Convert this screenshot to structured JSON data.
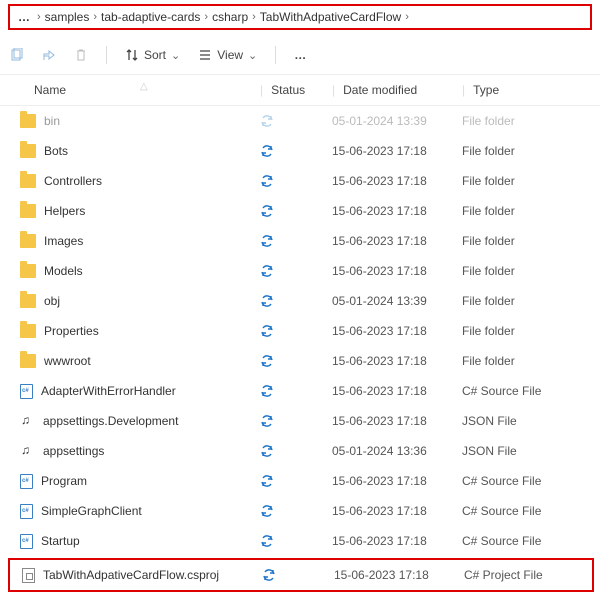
{
  "breadcrumb": {
    "items": [
      "samples",
      "tab-adaptive-cards",
      "csharp",
      "TabWithAdpativeCardFlow"
    ]
  },
  "toolbar": {
    "sort_label": "Sort",
    "view_label": "View"
  },
  "headers": {
    "name": "Name",
    "status": "Status",
    "date": "Date modified",
    "type": "Type"
  },
  "rows": [
    {
      "icon": "folder",
      "name": "bin",
      "date": "05-01-2024 13:39",
      "type": "File folder",
      "faded": true
    },
    {
      "icon": "folder",
      "name": "Bots",
      "date": "15-06-2023 17:18",
      "type": "File folder",
      "faded": false
    },
    {
      "icon": "folder",
      "name": "Controllers",
      "date": "15-06-2023 17:18",
      "type": "File folder",
      "faded": false
    },
    {
      "icon": "folder",
      "name": "Helpers",
      "date": "15-06-2023 17:18",
      "type": "File folder",
      "faded": false
    },
    {
      "icon": "folder",
      "name": "Images",
      "date": "15-06-2023 17:18",
      "type": "File folder",
      "faded": false
    },
    {
      "icon": "folder",
      "name": "Models",
      "date": "15-06-2023 17:18",
      "type": "File folder",
      "faded": false
    },
    {
      "icon": "folder",
      "name": "obj",
      "date": "05-01-2024 13:39",
      "type": "File folder",
      "faded": false
    },
    {
      "icon": "folder",
      "name": "Properties",
      "date": "15-06-2023 17:18",
      "type": "File folder",
      "faded": false
    },
    {
      "icon": "folder",
      "name": "wwwroot",
      "date": "15-06-2023 17:18",
      "type": "File folder",
      "faded": false
    },
    {
      "icon": "csfile",
      "name": "AdapterWithErrorHandler",
      "date": "15-06-2023 17:18",
      "type": "C# Source File",
      "faded": false
    },
    {
      "icon": "jsonfile",
      "name": "appsettings.Development",
      "date": "15-06-2023 17:18",
      "type": "JSON File",
      "faded": false
    },
    {
      "icon": "jsonfile",
      "name": "appsettings",
      "date": "05-01-2024 13:36",
      "type": "JSON File",
      "faded": false
    },
    {
      "icon": "csfile",
      "name": "Program",
      "date": "15-06-2023 17:18",
      "type": "C# Source File",
      "faded": false
    },
    {
      "icon": "csfile",
      "name": "SimpleGraphClient",
      "date": "15-06-2023 17:18",
      "type": "C# Source File",
      "faded": false
    },
    {
      "icon": "csfile",
      "name": "Startup",
      "date": "15-06-2023 17:18",
      "type": "C# Source File",
      "faded": false
    }
  ],
  "highlight_row": {
    "icon": "projfile",
    "name": "TabWithAdpativeCardFlow.csproj",
    "date": "15-06-2023 17:18",
    "type": "C# Project File"
  }
}
